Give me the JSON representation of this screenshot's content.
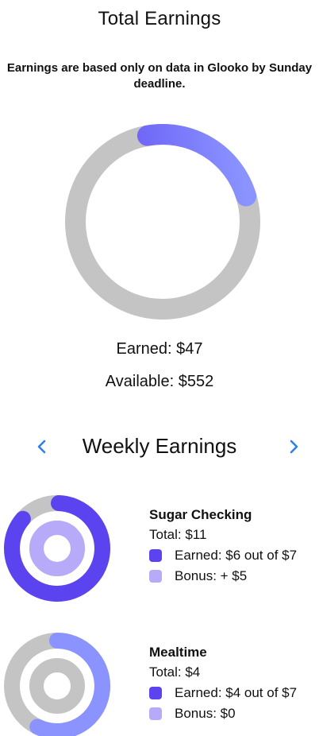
{
  "header": {
    "title": "Total Earnings",
    "subtitle": "Earnings are based only on data in Glooko by Sunday deadline."
  },
  "colors": {
    "track": "#c4c4c4",
    "earned": "#5b43f0",
    "earned_light": "#8a93ff",
    "bonus": "#b7aaf8",
    "arrow": "#2f80ed"
  },
  "total": {
    "earned_label": "Earned: $47",
    "available_label": "Available: $552",
    "earned_fraction": 0.23
  },
  "weekly": {
    "title": "Weekly Earnings",
    "prev_icon": "chevron-left-icon",
    "next_icon": "chevron-right-icon"
  },
  "categories": [
    {
      "name": "Sugar Checking",
      "total": "Total: $11",
      "earned_label": "Earned: $6 out of $7",
      "bonus_label": "Bonus: + $5",
      "earned_fraction": 0.857,
      "bonus_fraction": 1.0
    },
    {
      "name": "Mealtime",
      "total": "Total: $4",
      "earned_label": "Earned: $4 out of $7",
      "bonus_label": "Bonus: $0",
      "earned_fraction": 0.571,
      "bonus_fraction": 0.0
    }
  ]
}
